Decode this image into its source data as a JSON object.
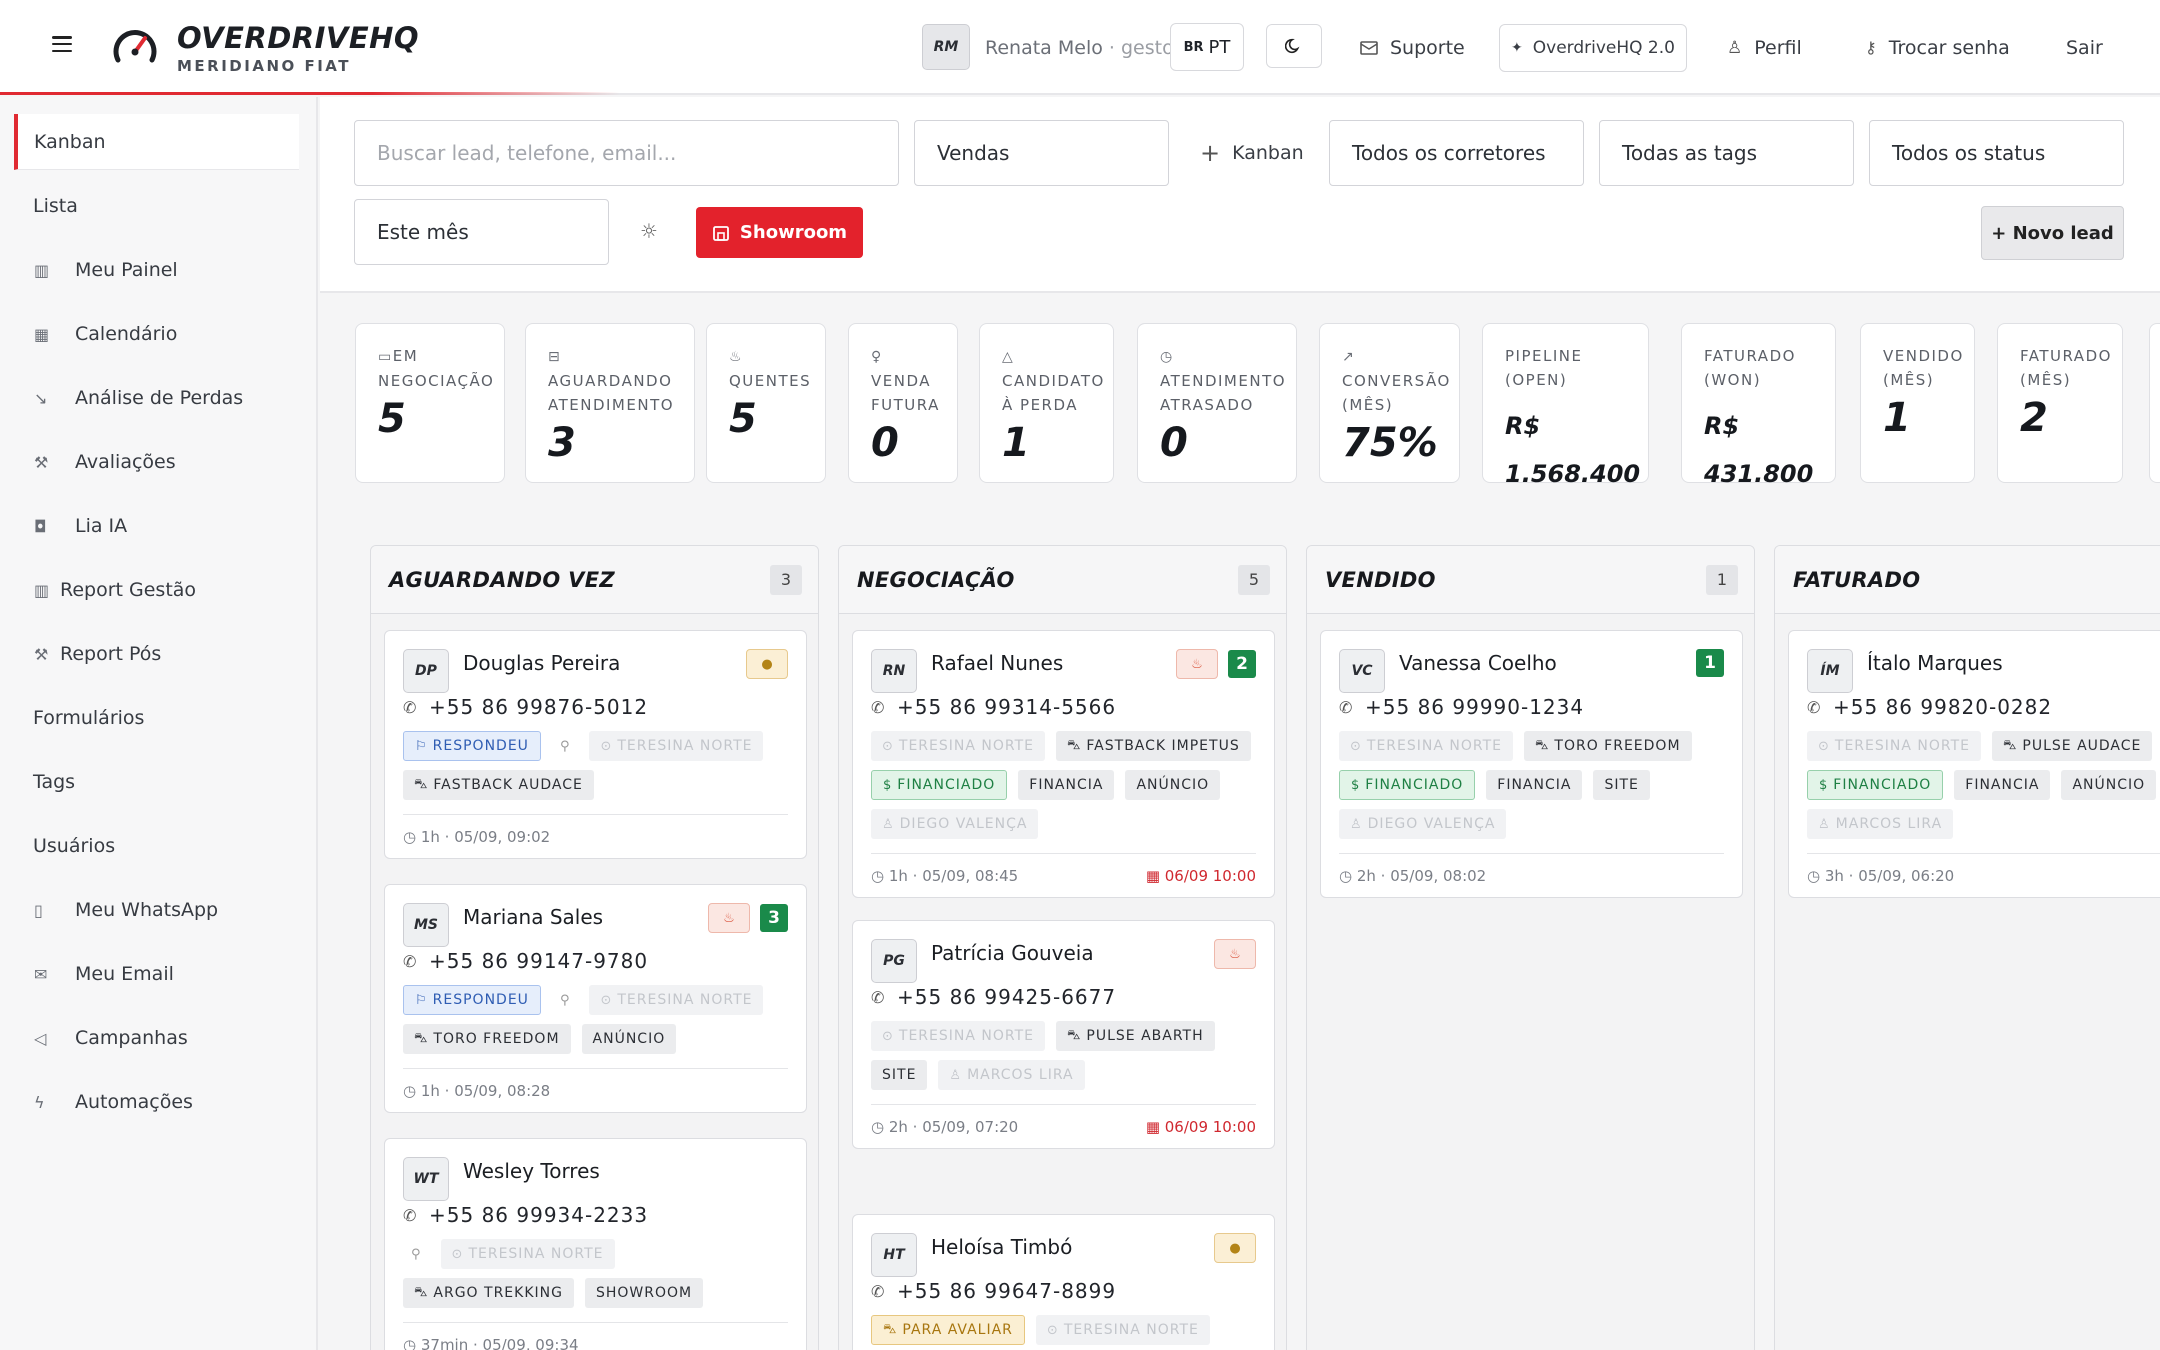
{
  "header": {
    "brand": "OVERDRIVEHQ",
    "sub": "MERIDIANO FIAT",
    "user_initials": "RM",
    "user_name": "Renata Melo",
    "user_role": "· gestor",
    "lang_flag": "BR",
    "lang": "PT",
    "suporte": "Suporte",
    "version": "OverdriveHQ 2.0",
    "perfil": "Perfil",
    "trocar": "Trocar senha",
    "sair": "Sair"
  },
  "sidebar": {
    "items": [
      {
        "label": "Kanban",
        "icon": ""
      },
      {
        "label": "Lista",
        "icon": ""
      },
      {
        "label": "Meu Painel",
        "icon": "bar-chart-icon"
      },
      {
        "label": "Calendário",
        "icon": "calendar-icon"
      },
      {
        "label": "Análise de Perdas",
        "icon": "trend-down-icon"
      },
      {
        "label": "Avaliações",
        "icon": "wrench-icon"
      },
      {
        "label": "Lia IA",
        "icon": "robot-icon"
      },
      {
        "label": "Report Gestão",
        "icon": "bar-chart-icon"
      },
      {
        "label": "Report Pós",
        "icon": "wrench-icon"
      },
      {
        "label": "Formulários",
        "icon": ""
      },
      {
        "label": "Tags",
        "icon": ""
      },
      {
        "label": "Usuários",
        "icon": ""
      },
      {
        "label": "Meu WhatsApp",
        "icon": "phone-icon"
      },
      {
        "label": "Meu Email",
        "icon": "mail-icon"
      },
      {
        "label": "Campanhas",
        "icon": "megaphone-icon"
      },
      {
        "label": "Automações",
        "icon": "bolt-icon"
      }
    ]
  },
  "filters": {
    "search_placeholder": "Buscar lead, telefone, email...",
    "pipeline": "Vendas",
    "add_kanban": "Kanban",
    "corretores": "Todos os corretores",
    "tags": "Todas as tags",
    "status": "Todos os status",
    "periodo": "Este mês",
    "showroom": "Showroom",
    "novo": "+ Novo lead"
  },
  "stats": [
    {
      "label": "Em negociação",
      "value": "5",
      "icon": "folder-icon"
    },
    {
      "label": "Aguardando atendimento",
      "value": "3",
      "icon": "inbox-icon"
    },
    {
      "label": "Quentes",
      "value": "5",
      "icon": "flame-icon"
    },
    {
      "label": "Venda futura",
      "value": "0",
      "icon": "bulb-icon"
    },
    {
      "label": "Candidato à perda",
      "value": "1",
      "icon": "warning-icon"
    },
    {
      "label": "Atendimento atrasado",
      "value": "0",
      "icon": "clock-icon"
    },
    {
      "label": "Conversão (mês)",
      "value": "75%",
      "icon": "trend-up-icon"
    },
    {
      "label": "Pipeline (open)",
      "value": "R$ 1.568.400",
      "icon": ""
    },
    {
      "label": "Faturado (won)",
      "value": "R$ 431.800",
      "icon": ""
    },
    {
      "label": "Vendido (mês)",
      "value": "1",
      "icon": ""
    },
    {
      "label": "Faturado (mês)",
      "value": "2",
      "icon": ""
    }
  ],
  "columns": [
    {
      "title": "AGUARDANDO VEZ",
      "count": "3",
      "cards": [
        {
          "initials": "DP",
          "name": "Douglas Pereira",
          "flag": "warm",
          "flag_text": "●",
          "count": "",
          "phone": "+55  86  99876-5012",
          "chips": [
            {
              "t": "RESPONDEU",
              "k": "blue",
              "i": "⚐"
            },
            {
              "t": "",
              "k": "pin",
              "i": "⚲"
            },
            {
              "t": "TERESINA NORTE",
              "k": "faded",
              "i": "⊙"
            },
            {
              "t": "FASTBACK AUDACE",
              "k": "",
              "i": "⛍"
            }
          ],
          "time": "1h · 05/09, 09:02",
          "due": ""
        },
        {
          "initials": "MS",
          "name": "Mariana Sales",
          "flag": "hot",
          "flag_text": "♨",
          "count": "3",
          "phone": "+55  86  99147-9780",
          "chips": [
            {
              "t": "RESPONDEU",
              "k": "blue",
              "i": "⚐"
            },
            {
              "t": "",
              "k": "pin",
              "i": "⚲"
            },
            {
              "t": "TERESINA NORTE",
              "k": "faded",
              "i": "⊙"
            },
            {
              "t": "TORO FREEDOM",
              "k": "",
              "i": "⛍"
            },
            {
              "t": "ANÚNCIO",
              "k": "",
              "i": ""
            }
          ],
          "time": "1h · 05/09, 08:28",
          "due": ""
        },
        {
          "initials": "WT",
          "name": "Wesley Torres",
          "flag": "",
          "flag_text": "",
          "count": "",
          "phone": "+55  86  99934-2233",
          "chips": [
            {
              "t": "",
              "k": "pin",
              "i": "⚲"
            },
            {
              "t": "TERESINA NORTE",
              "k": "faded",
              "i": "⊙"
            },
            {
              "t": "ARGO TREKKING",
              "k": "",
              "i": "⛍"
            },
            {
              "t": "SHOWROOM",
              "k": "",
              "i": ""
            }
          ],
          "time": "37min · 05/09, 09:34",
          "due": ""
        }
      ]
    },
    {
      "title": "NEGOCIAÇÃO",
      "count": "5",
      "cards": [
        {
          "initials": "RN",
          "name": "Rafael Nunes",
          "flag": "hot",
          "flag_text": "♨",
          "count": "2",
          "phone": "+55  86  99314-5566",
          "chips": [
            {
              "t": "TERESINA NORTE",
              "k": "faded",
              "i": "⊙"
            },
            {
              "t": "FASTBACK IMPETUS",
              "k": "",
              "i": "⛍"
            },
            {
              "t": "FINANCIADO",
              "k": "green",
              "i": "$"
            },
            {
              "t": "FINANCIA",
              "k": "",
              "i": ""
            },
            {
              "t": "ANÚNCIO",
              "k": "",
              "i": ""
            },
            {
              "t": "DIEGO VALENÇA",
              "k": "faded",
              "i": "♙"
            }
          ],
          "time": "1h · 05/09, 08:45",
          "due": "06/09 10:00"
        },
        {
          "initials": "PG",
          "name": "Patrícia Gouveia",
          "flag": "hot",
          "flag_text": "♨",
          "count": "",
          "phone": "+55  86  99425-6677",
          "chips": [
            {
              "t": "TERESINA NORTE",
              "k": "faded",
              "i": "⊙"
            },
            {
              "t": "PULSE ABARTH",
              "k": "",
              "i": "⛍"
            },
            {
              "t": "SITE",
              "k": "",
              "i": ""
            },
            {
              "t": "MARCOS LIRA",
              "k": "faded",
              "i": "♙"
            }
          ],
          "time": "2h · 05/09, 07:20",
          "due": "06/09 10:00"
        },
        {
          "initials": "HT",
          "name": "Heloísa Timbó",
          "flag": "warm",
          "flag_text": "●",
          "count": "",
          "phone": "+55  86  99647-8899",
          "chips": [
            {
              "t": "PARA AVALIAR",
              "k": "yellow",
              "i": "⛍"
            },
            {
              "t": "TERESINA NORTE",
              "k": "faded",
              "i": "⊙"
            }
          ],
          "time": "",
          "due": ""
        }
      ]
    },
    {
      "title": "VENDIDO",
      "count": "1",
      "cards": [
        {
          "initials": "VC",
          "name": "Vanessa Coelho",
          "flag": "",
          "flag_text": "",
          "count": "1",
          "phone": "+55  86  99990-1234",
          "chips": [
            {
              "t": "TERESINA NORTE",
              "k": "faded",
              "i": "⊙"
            },
            {
              "t": "TORO FREEDOM",
              "k": "",
              "i": "⛍"
            },
            {
              "t": "FINANCIADO",
              "k": "green",
              "i": "$"
            },
            {
              "t": "FINANCIA",
              "k": "",
              "i": ""
            },
            {
              "t": "SITE",
              "k": "",
              "i": ""
            },
            {
              "t": "DIEGO VALENÇA",
              "k": "faded",
              "i": "♙"
            }
          ],
          "time": "2h · 05/09, 08:02",
          "due": ""
        }
      ]
    },
    {
      "title": "FATURADO",
      "count": "",
      "cards": [
        {
          "initials": "ÍM",
          "name": "Ítalo Marques",
          "flag": "",
          "flag_text": "",
          "count": "",
          "phone": "+55  86  99820-0282",
          "chips": [
            {
              "t": "TERESINA NORTE",
              "k": "faded",
              "i": "⊙"
            },
            {
              "t": "PULSE AUDACE",
              "k": "",
              "i": "⛍"
            },
            {
              "t": "FINANCIADO",
              "k": "green",
              "i": "$"
            },
            {
              "t": "FINANCIA",
              "k": "",
              "i": ""
            },
            {
              "t": "ANÚNCIO",
              "k": "",
              "i": ""
            },
            {
              "t": "MARCOS LIRA",
              "k": "faded",
              "i": "♙"
            }
          ],
          "time": "3h · 05/09, 06:20",
          "due": ""
        }
      ]
    }
  ]
}
